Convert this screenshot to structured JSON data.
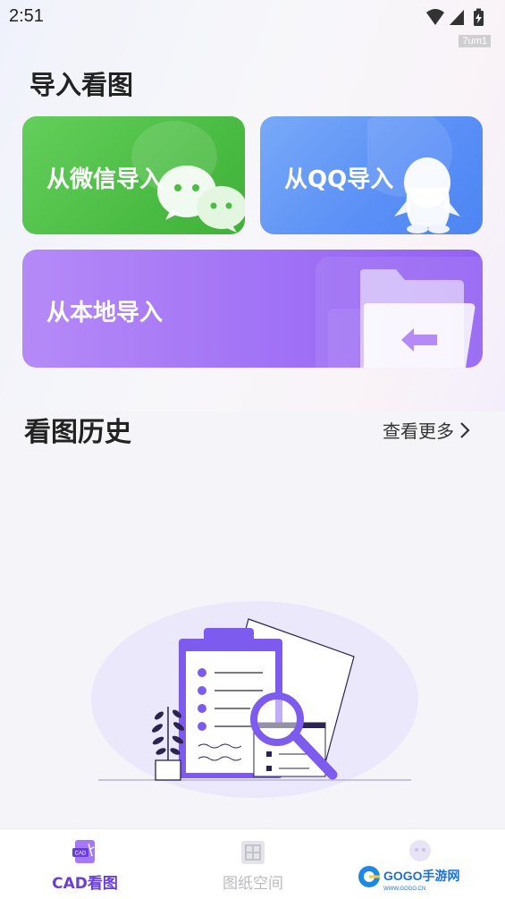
{
  "status_bar": {
    "time": "2:51",
    "icons": [
      "wifi-icon",
      "signal-icon",
      "battery-charging-icon"
    ],
    "tag": "7um1"
  },
  "import": {
    "title": "导入看图",
    "wechat_label": "从微信导入",
    "qq_label": "从QQ导入",
    "local_label": "从本地导入",
    "colors": {
      "wechat": "#4cbd44",
      "qq": "#5a8ff6",
      "local": "#a274f6"
    }
  },
  "history": {
    "title": "看图历史",
    "more_label": "查看更多"
  },
  "tabs": [
    {
      "label": "CAD看图",
      "icon": "cad-file-icon",
      "active": true,
      "color": "#6a3fd8"
    },
    {
      "label": "图纸空间",
      "icon": "drawing-space-icon",
      "active": false,
      "color": "#b9b9c0"
    },
    {
      "label": "",
      "icon": "profile-ghost-icon",
      "active": false,
      "color": "#b9b9c0"
    }
  ],
  "watermark": {
    "text": "GOGO手游网",
    "sub": "WWW.GOGO.CN"
  }
}
